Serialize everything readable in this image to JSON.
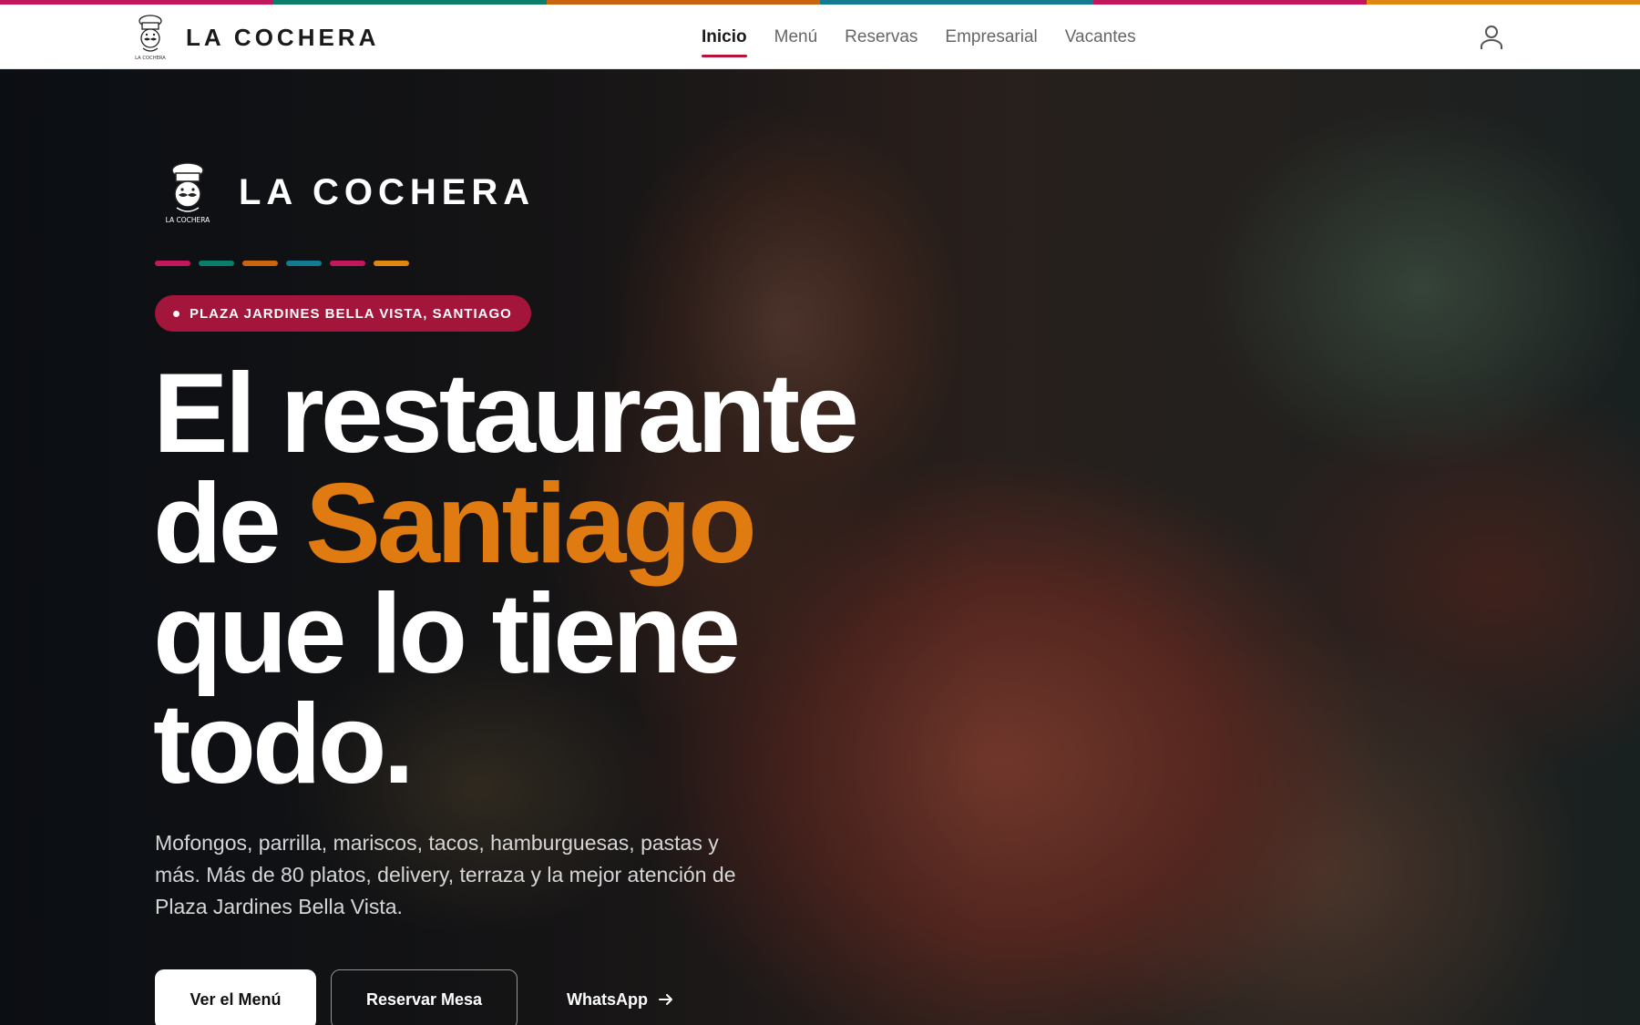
{
  "header": {
    "brand_name": "LA COCHERA",
    "logo_caption": "LA COCHERA",
    "nav": [
      "Inicio",
      "Menú",
      "Reservas",
      "Empresarial",
      "Vacantes"
    ],
    "active_nav": "Inicio"
  },
  "colors": {
    "stripe": [
      "#c2185b",
      "#0a7d6b",
      "#c9650f",
      "#137a90",
      "#c2185b",
      "#e0870f"
    ],
    "dashes": [
      "#c2185b",
      "#0a7d6b",
      "#c9650f",
      "#137a90",
      "#c2185b",
      "#e0870f"
    ],
    "accent_orange": "#e07b12",
    "badge_red": "#a3153a"
  },
  "hero": {
    "brand_name": "LA COCHERA",
    "logo_caption": "LA COCHERA",
    "badge": "PLAZA JARDINES BELLA VISTA, SANTIAGO",
    "headline_line1": "El restaurante",
    "headline_de": "de",
    "headline_accent": "Santiago",
    "headline_line3": "que lo tiene",
    "headline_line4": "todo.",
    "description": "Mofongos, parrilla, mariscos, tacos, hamburguesas, pastas y más. Más de 80 platos, delivery, terraza y la mejor atención de Plaza Jardines Bella Vista.",
    "buttons": {
      "menu": "Ver el Menú",
      "reserve": "Reservar Mesa",
      "whatsapp": "WhatsApp"
    }
  },
  "icons": {
    "user": "user-icon",
    "arrow": "arrow-right-icon",
    "logo": "chef-logo-icon"
  }
}
